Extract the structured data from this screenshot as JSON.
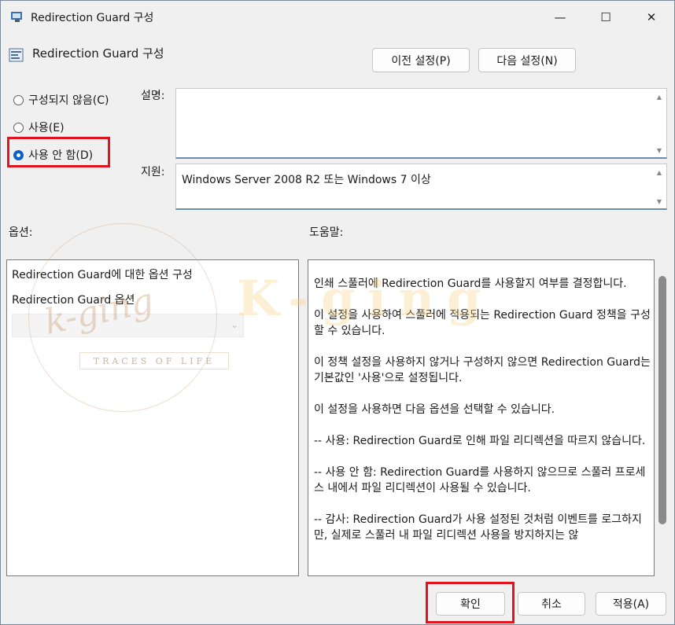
{
  "window": {
    "title": "Redirection Guard 구성",
    "controls": {
      "minimize": "—",
      "maximize": "☐",
      "close": "✕"
    }
  },
  "header": {
    "title": "Redirection  Guard 구성",
    "prev_label": "이전 설정(P)",
    "next_label": "다음 설정(N)"
  },
  "state": {
    "options": [
      {
        "label": "구성되지 않음(C)",
        "selected": false
      },
      {
        "label": "사용(E)",
        "selected": false
      },
      {
        "label": "사용 안 함(D)",
        "selected": true
      }
    ]
  },
  "description": {
    "label": "설명:",
    "text": ""
  },
  "supported": {
    "label": "지원:",
    "text": "Windows Server 2008 R2 또는 Windows 7 이상"
  },
  "options_section": {
    "label": "옵션:",
    "lines": [
      "Redirection  Guard에 대한 옵션 구성",
      "Redirection  Guard 옵션"
    ],
    "combo_value": ""
  },
  "help_section": {
    "label": "도움말:",
    "paragraphs": [
      "인쇄 스풀러에 Redirection Guard를 사용할지 여부를 결정합니다.",
      "이 설정을 사용하여 스풀러에 적용되는 Redirection Guard 정책을 구성할 수 있습니다.",
      "이 정책 설정을 사용하지 않거나 구성하지 않으면 Redirection Guard는 기본값인 '사용'으로 설정됩니다.",
      "이 설정을 사용하면 다음 옵션을 선택할 수 있습니다.",
      "-- 사용: Redirection Guard로 인해 파일 리디렉션을 따르지 않습니다.",
      "-- 사용 안 함: Redirection Guard를 사용하지 않으므로 스풀러 프로세스 내에서 파일 리디렉션이 사용될 수 있습니다.",
      "-- 감사: Redirection Guard가 사용 설정된 것처럼 이벤트를 로그하지만, 실제로 스풀러 내 파일 리디렉션 사용을 방지하지는 않"
    ]
  },
  "footer": {
    "ok": "확인",
    "cancel": "취소",
    "apply": "적용(A)"
  },
  "watermark": {
    "script": "k-ging",
    "tagline": "TRACES OF LIFE",
    "big": "K-ging"
  },
  "colors": {
    "highlight": "#e0141e",
    "radio_selected": "#0b5fc7"
  }
}
